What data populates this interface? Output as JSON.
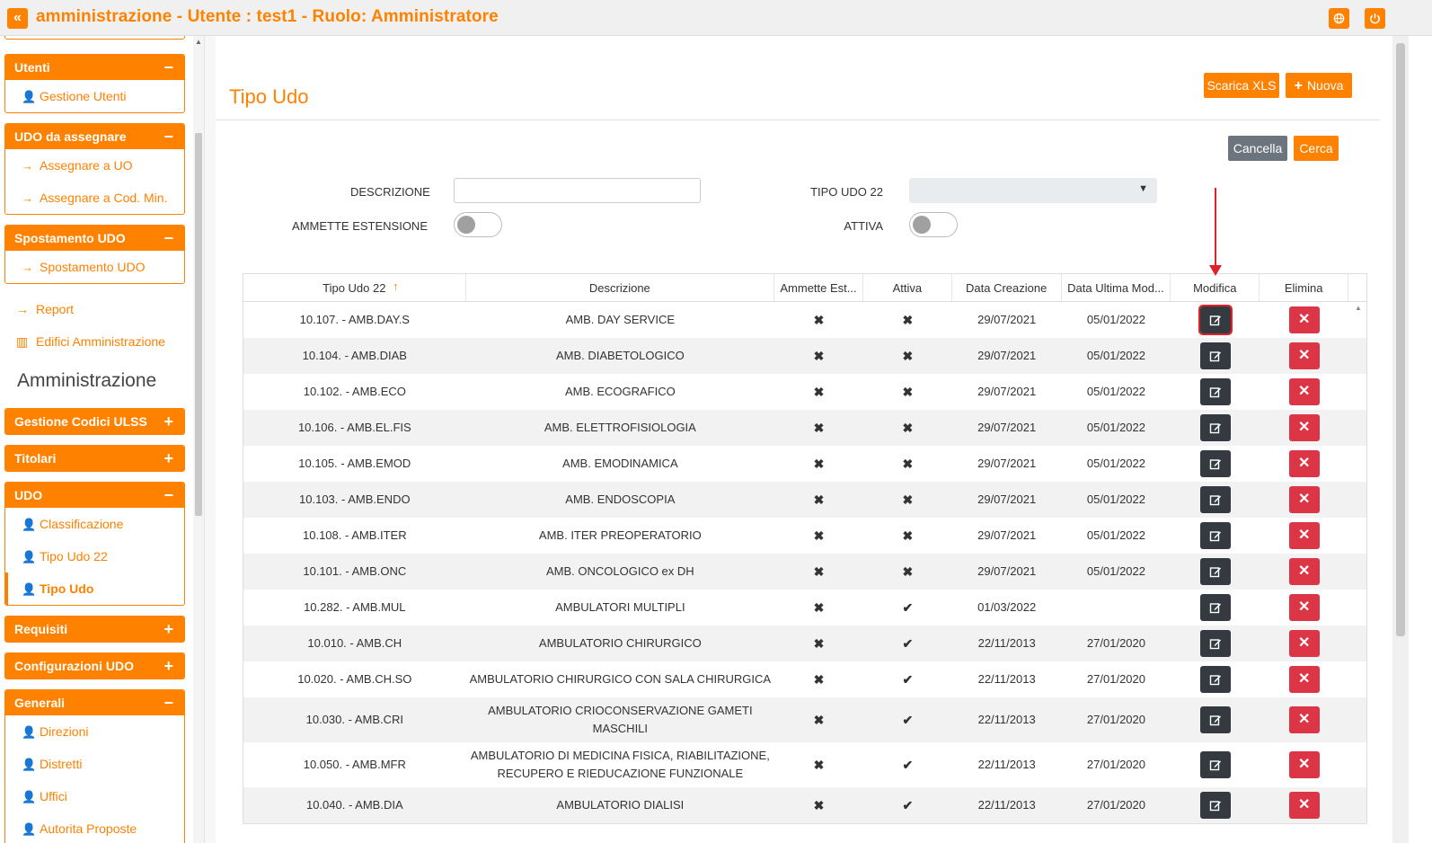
{
  "header": {
    "collapse_icon": "«",
    "title": "amministrazione - Utente : test1 - Ruolo: Amministratore",
    "colors": {
      "accent": "#ff8100"
    }
  },
  "sidebar": {
    "groups": [
      {
        "title": "Utenti",
        "sign": "−",
        "items": [
          {
            "label": "Gestione Utenti",
            "icon": "user-key-icon"
          }
        ]
      },
      {
        "title": "UDO da assegnare",
        "sign": "−",
        "items": [
          {
            "label": "Assegnare a UO",
            "icon": "arrow-right-icon"
          },
          {
            "label": "Assegnare a Cod. Min.",
            "icon": "arrow-right-icon"
          }
        ]
      },
      {
        "title": "Spostamento UDO",
        "sign": "−",
        "items": [
          {
            "label": "Spostamento UDO",
            "icon": "arrow-right-icon"
          }
        ]
      }
    ],
    "links": [
      {
        "label": "Report",
        "icon": "arrow-right-icon"
      },
      {
        "label": "Edifici Amministrazione",
        "icon": "building-icon"
      }
    ],
    "section_title": "Amministrazione",
    "groups2": [
      {
        "title": "Gestione Codici ULSS",
        "sign": "+"
      },
      {
        "title": "Titolari",
        "sign": "+"
      },
      {
        "title": "UDO",
        "sign": "−",
        "items": [
          {
            "label": "Classificazione"
          },
          {
            "label": "Tipo Udo 22"
          },
          {
            "label": "Tipo Udo"
          }
        ]
      },
      {
        "title": "Requisiti",
        "sign": "+"
      },
      {
        "title": "Configurazioni UDO",
        "sign": "+"
      },
      {
        "title": "Generali",
        "sign": "−",
        "items": [
          {
            "label": "Direzioni"
          },
          {
            "label": "Distretti"
          },
          {
            "label": "Uffici"
          },
          {
            "label": "Autorita Proposte"
          }
        ]
      }
    ]
  },
  "main": {
    "page_title": "Tipo Udo",
    "buttons": {
      "download": "Scarica XLS",
      "new": "Nuova",
      "cancel": "Cancella",
      "search": "Cerca"
    },
    "filters": {
      "descrizione_label": "DESCRIZIONE",
      "descrizione_value": "",
      "tipo_udo22_label": "TIPO UDO 22",
      "tipo_udo22_value": "",
      "ammette_label": "AMMETTE ESTENSIONE",
      "attiva_label": "ATTIVA"
    },
    "table": {
      "headers": [
        "Tipo Udo 22",
        "Descrizione",
        "Ammette Est...",
        "Attiva",
        "Data Creazione",
        "Data Ultima Mod...",
        "Modifica",
        "Elimina"
      ],
      "sort_icon": "↑",
      "rows": [
        {
          "tipo": "10.107. - AMB.DAY.S",
          "desc": "AMB. DAY SERVICE",
          "ammette": "✖",
          "attiva": "✖",
          "creazione": "29/07/2021",
          "modifica": "05/01/2022"
        },
        {
          "tipo": "10.104. - AMB.DIAB",
          "desc": "AMB. DIABETOLOGICO",
          "ammette": "✖",
          "attiva": "✖",
          "creazione": "29/07/2021",
          "modifica": "05/01/2022"
        },
        {
          "tipo": "10.102. - AMB.ECO",
          "desc": "AMB. ECOGRAFICO",
          "ammette": "✖",
          "attiva": "✖",
          "creazione": "29/07/2021",
          "modifica": "05/01/2022"
        },
        {
          "tipo": "10.106. - AMB.EL.FIS",
          "desc": "AMB. ELETTROFISIOLOGIA",
          "ammette": "✖",
          "attiva": "✖",
          "creazione": "29/07/2021",
          "modifica": "05/01/2022"
        },
        {
          "tipo": "10.105. - AMB.EMOD",
          "desc": "AMB. EMODINAMICA",
          "ammette": "✖",
          "attiva": "✖",
          "creazione": "29/07/2021",
          "modifica": "05/01/2022"
        },
        {
          "tipo": "10.103. - AMB.ENDO",
          "desc": "AMB. ENDOSCOPIA",
          "ammette": "✖",
          "attiva": "✖",
          "creazione": "29/07/2021",
          "modifica": "05/01/2022"
        },
        {
          "tipo": "10.108. - AMB.ITER",
          "desc": "AMB. ITER PREOPERATORIO",
          "ammette": "✖",
          "attiva": "✖",
          "creazione": "29/07/2021",
          "modifica": "05/01/2022"
        },
        {
          "tipo": "10.101. - AMB.ONC",
          "desc": "AMB. ONCOLOGICO ex DH",
          "ammette": "✖",
          "attiva": "✖",
          "creazione": "29/07/2021",
          "modifica": "05/01/2022"
        },
        {
          "tipo": "10.282. - AMB.MUL",
          "desc": "AMBULATORI MULTIPLI",
          "ammette": "✖",
          "attiva": "✔",
          "creazione": "01/03/2022",
          "modifica": ""
        },
        {
          "tipo": "10.010. - AMB.CH",
          "desc": "AMBULATORIO CHIRURGICO",
          "ammette": "✖",
          "attiva": "✔",
          "creazione": "22/11/2013",
          "modifica": "27/01/2020"
        },
        {
          "tipo": "10.020. - AMB.CH.SO",
          "desc": "AMBULATORIO CHIRURGICO CON SALA CHIRURGICA",
          "ammette": "✖",
          "attiva": "✔",
          "creazione": "22/11/2013",
          "modifica": "27/01/2020"
        },
        {
          "tipo": "10.030. - AMB.CRI",
          "desc": "AMBULATORIO CRIOCONSERVAZIONE GAMETI MASCHILI",
          "ammette": "✖",
          "attiva": "✔",
          "creazione": "22/11/2013",
          "modifica": "27/01/2020"
        },
        {
          "tipo": "10.050. - AMB.MFR",
          "desc": "AMBULATORIO DI MEDICINA FISICA, RIABILITAZIONE, RECUPERO E RIEDUCAZIONE FUNZIONALE",
          "ammette": "✖",
          "attiva": "✔",
          "creazione": "22/11/2013",
          "modifica": "27/01/2020"
        },
        {
          "tipo": "10.040. - AMB.DIA",
          "desc": "AMBULATORIO DIALISI",
          "ammette": "✖",
          "attiva": "✔",
          "creazione": "22/11/2013",
          "modifica": "27/01/2020"
        }
      ]
    }
  }
}
